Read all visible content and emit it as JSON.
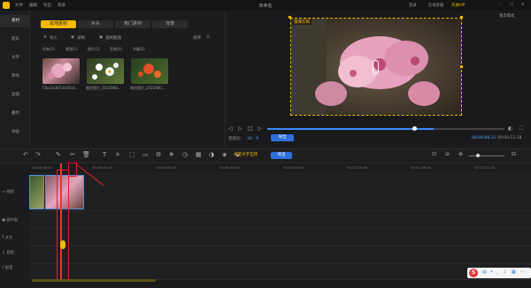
{
  "app": {
    "title": "未命名",
    "menu": [
      "文件",
      "编辑",
      "导出",
      "帮助"
    ],
    "title_right": [
      "登录",
      "在线客服",
      "开通VIP"
    ],
    "window_buttons": [
      "–",
      "▢",
      "✕"
    ]
  },
  "sidebar": {
    "items": [
      {
        "label": "素材",
        "active": true
      },
      {
        "label": "配乐"
      },
      {
        "label": "文字"
      },
      {
        "label": "转场"
      },
      {
        "label": "滤镜"
      },
      {
        "label": "叠附"
      },
      {
        "label": "动画"
      }
    ]
  },
  "tabs": [
    {
      "label": "本地素材",
      "active": true
    },
    {
      "label": "片头"
    },
    {
      "label": "热门素材"
    },
    {
      "label": "背景"
    }
  ],
  "import_bar": {
    "import": "导入",
    "record": "录制",
    "frame": "逐帧截图",
    "sort": "排序"
  },
  "filters": [
    {
      "label": "所有(3)",
      "selected": true
    },
    {
      "label": "视频(1)"
    },
    {
      "label": "图片(2)"
    },
    {
      "label": "音频(0)"
    },
    {
      "label": "字幕(0)"
    }
  ],
  "media": [
    {
      "name": "73bc3a3b73e54cd..."
    },
    {
      "name": "微信图片_2022080..."
    },
    {
      "name": "微信图片_2022080..."
    }
  ],
  "preview": {
    "watermark": "蜜蜂剪辑",
    "fullscreen": "独享模式",
    "ratio_label": "宽高比：",
    "ratio": "16：9",
    "export": "导出",
    "current_time": "00:00:08.11",
    "total_time": "00:00:13.18",
    "progress": 0.69
  },
  "toolbar": {
    "tool_icons": [
      "undo-icon",
      "redo-icon",
      "pen-icon",
      "scissors-icon",
      "delete-icon",
      "text-icon",
      "crop-icon",
      "keyframe-icon",
      "video-icon",
      "speed-icon",
      "freeze-icon",
      "clock-icon",
      "mosaic-icon",
      "color-icon",
      "filter-icon",
      "fill-icon"
    ],
    "tooltip": "分割",
    "voice_to_text": "语音文字互转",
    "export": "导出"
  },
  "ruler": [
    "00:00:00.00",
    "00:00:16.00",
    "00:00:32.00",
    "00:00:48.00",
    "00:01:04.00",
    "00:01:20.00",
    "00:01:36.00",
    "00:01:52.00"
  ],
  "tracks": [
    {
      "label": "视频"
    },
    {
      "label": "画中画"
    },
    {
      "label": "文字"
    },
    {
      "label": "音频"
    },
    {
      "label": "配音"
    }
  ],
  "tray": {
    "logo": "S",
    "items": [
      "中",
      "•",
      "、",
      "♪",
      "▦",
      "⋯"
    ]
  },
  "colors": {
    "accent": "#f3b800",
    "blue": "#2e6fdc",
    "red_highlight": "#e02020"
  }
}
